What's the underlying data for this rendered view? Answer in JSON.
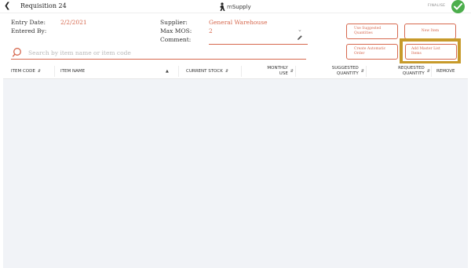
{
  "header": {
    "title": "Requisition 24",
    "logo_prefix": "m",
    "logo_name": "Supply",
    "finalise_label": "FINALISE"
  },
  "info": {
    "entry_date_label": "Entry Date:",
    "entry_date_value": "2/2/2021",
    "entered_by_label": "Entered By:",
    "entered_by_value": "",
    "supplier_label": "Supplier:",
    "supplier_value": "General Warehouse",
    "max_mos_label": "Max MOS:",
    "max_mos_value": "2",
    "comment_label": "Comment:",
    "comment_value": ""
  },
  "search": {
    "placeholder": "Search by item name or item code",
    "value": ""
  },
  "actions": {
    "use_suggested_line1": "Use Suggested",
    "use_suggested_line2": "Quantities",
    "new_item": "New Item",
    "create_auto_line1": "Create Automatic",
    "create_auto_line2": "Order",
    "add_master_line1": "Add Master List",
    "add_master_line2": "Items"
  },
  "table": {
    "columns": {
      "item_code": "ITEM CODE",
      "item_name": "ITEM NAME",
      "current_stock": "CURRENT STOCK",
      "monthly_use_1": "MONTHLY",
      "monthly_use_2": "USE",
      "suggested_1": "SUGGESTED",
      "suggested_2": "QUANTITY",
      "requested_1": "REQUESTED",
      "requested_2": "QUANTITY",
      "remove": "REMOVE"
    },
    "rows": []
  },
  "colors": {
    "accent": "#d6684e",
    "confirm": "#4cae4c",
    "highlight": "#c79a2a",
    "table_body": "#f1f3f7"
  }
}
